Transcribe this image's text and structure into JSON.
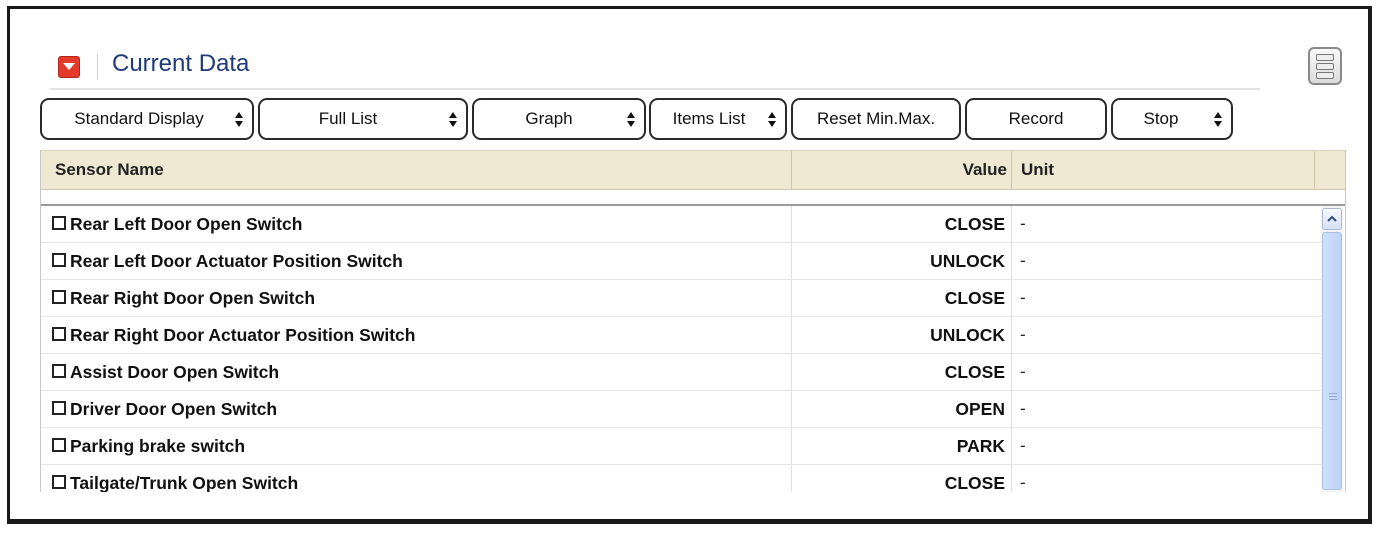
{
  "panel": {
    "title": "Current Data"
  },
  "toolbar": {
    "buttons": [
      {
        "label": "Standard Display",
        "has_dropdown": true
      },
      {
        "label": "Full List",
        "has_dropdown": true
      },
      {
        "label": "Graph",
        "has_dropdown": true
      },
      {
        "label": "Items List",
        "has_dropdown": true
      },
      {
        "label": "Reset Min.Max.",
        "has_dropdown": false
      },
      {
        "label": "Record",
        "has_dropdown": false
      },
      {
        "label": "Stop",
        "has_dropdown": true
      }
    ]
  },
  "table": {
    "columns": {
      "name": "Sensor Name",
      "value": "Value",
      "unit": "Unit"
    },
    "rows": [
      {
        "name": "Rear Left Door Open Switch",
        "value": "CLOSE",
        "unit": "-"
      },
      {
        "name": "Rear Left Door Actuator Position Switch",
        "value": "UNLOCK",
        "unit": "-"
      },
      {
        "name": "Rear Right Door Open Switch",
        "value": "CLOSE",
        "unit": "-"
      },
      {
        "name": "Rear Right Door Actuator Position Switch",
        "value": "UNLOCK",
        "unit": "-"
      },
      {
        "name": "Assist Door Open Switch",
        "value": "CLOSE",
        "unit": "-"
      },
      {
        "name": "Driver Door Open Switch",
        "value": "OPEN",
        "unit": "-"
      },
      {
        "name": "Parking brake switch",
        "value": "PARK",
        "unit": "-"
      },
      {
        "name": "Tailgate/Trunk Open Switch",
        "value": "CLOSE",
        "unit": "-"
      }
    ]
  },
  "colors": {
    "title": "#1e3a7a",
    "collapse_button": "#e43a2a",
    "header_bg": "#efe9d3",
    "scrollbar_thumb": "#c6daf8"
  },
  "icons": {
    "collapse": "chevron-down-icon",
    "menu": "menu-icon",
    "scroll_up": "chevron-up-icon"
  }
}
